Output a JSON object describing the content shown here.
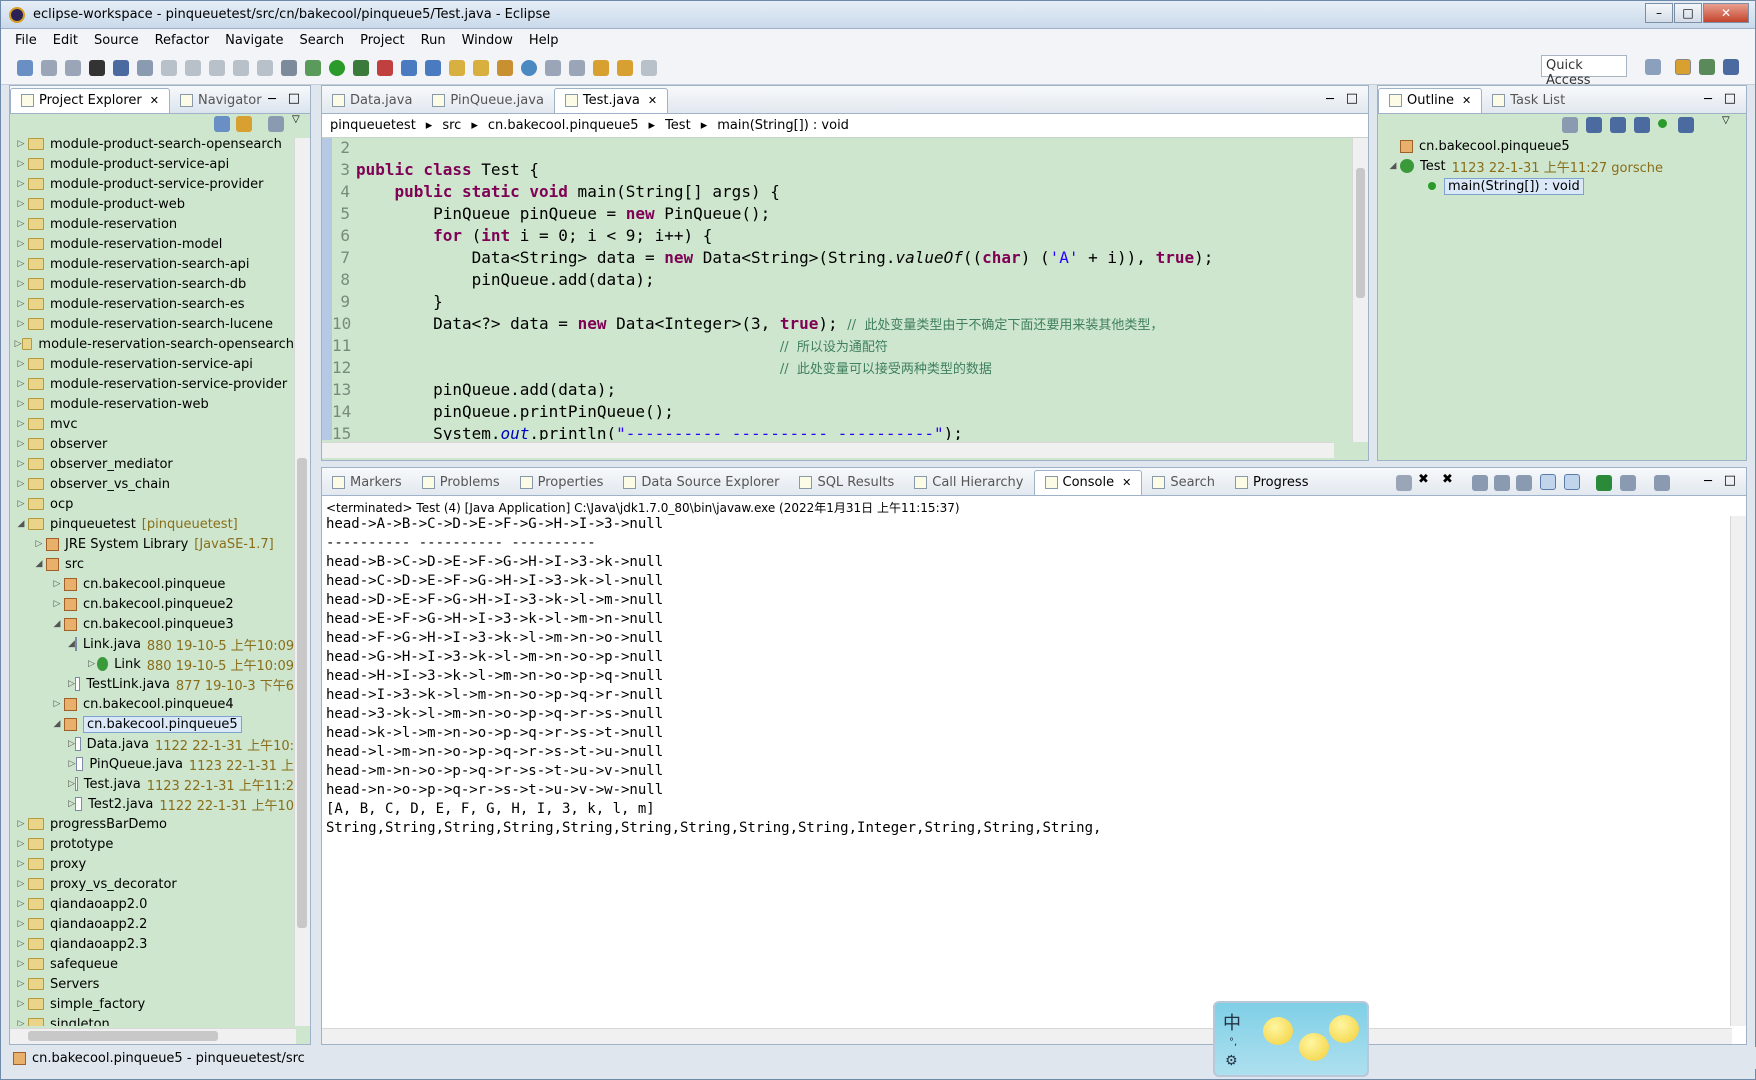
{
  "window": {
    "title": "eclipse-workspace - pinqueuetest/src/cn/bakecool/pinqueue5/Test.java - Eclipse"
  },
  "menu": [
    "File",
    "Edit",
    "Source",
    "Refactor",
    "Navigate",
    "Search",
    "Project",
    "Run",
    "Window",
    "Help"
  ],
  "quick_access": "Quick Access",
  "left": {
    "tabs": [
      "Project Explorer",
      "Navigator"
    ],
    "tree": [
      {
        "l": 0,
        "a": "▷",
        "i": "fold",
        "t": "module-product-search-opensearch"
      },
      {
        "l": 0,
        "a": "▷",
        "i": "fold",
        "t": "module-product-service-api"
      },
      {
        "l": 0,
        "a": "▷",
        "i": "fold",
        "t": "module-product-service-provider"
      },
      {
        "l": 0,
        "a": "▷",
        "i": "fold",
        "t": "module-product-web"
      },
      {
        "l": 0,
        "a": "▷",
        "i": "fold",
        "t": "module-reservation"
      },
      {
        "l": 0,
        "a": "▷",
        "i": "fold",
        "t": "module-reservation-model"
      },
      {
        "l": 0,
        "a": "▷",
        "i": "fold",
        "t": "module-reservation-search-api"
      },
      {
        "l": 0,
        "a": "▷",
        "i": "fold",
        "t": "module-reservation-search-db"
      },
      {
        "l": 0,
        "a": "▷",
        "i": "fold",
        "t": "module-reservation-search-es"
      },
      {
        "l": 0,
        "a": "▷",
        "i": "fold",
        "t": "module-reservation-search-lucene"
      },
      {
        "l": 0,
        "a": "▷",
        "i": "fold",
        "t": "module-reservation-search-opensearch"
      },
      {
        "l": 0,
        "a": "▷",
        "i": "fold",
        "t": "module-reservation-service-api"
      },
      {
        "l": 0,
        "a": "▷",
        "i": "fold",
        "t": "module-reservation-service-provider"
      },
      {
        "l": 0,
        "a": "▷",
        "i": "fold",
        "t": "module-reservation-web"
      },
      {
        "l": 0,
        "a": "▷",
        "i": "fold",
        "t": "mvc"
      },
      {
        "l": 0,
        "a": "▷",
        "i": "fold",
        "t": "observer"
      },
      {
        "l": 0,
        "a": "▷",
        "i": "fold",
        "t": "observer_mediator"
      },
      {
        "l": 0,
        "a": "▷",
        "i": "fold",
        "t": "observer_vs_chain"
      },
      {
        "l": 0,
        "a": "▷",
        "i": "fold",
        "t": "ocp"
      },
      {
        "l": 0,
        "a": "◢",
        "i": "fold",
        "t": "pinqueuetest",
        "m": "[pinqueuetest]"
      },
      {
        "l": 1,
        "a": "▷",
        "i": "pkg",
        "t": "JRE System Library",
        "m": "[JavaSE-1.7]"
      },
      {
        "l": 1,
        "a": "◢",
        "i": "pkg",
        "t": "src"
      },
      {
        "l": 2,
        "a": "▷",
        "i": "pkg",
        "t": "cn.bakecool.pinqueue"
      },
      {
        "l": 2,
        "a": "▷",
        "i": "pkg",
        "t": "cn.bakecool.pinqueue2"
      },
      {
        "l": 2,
        "a": "◢",
        "i": "pkg",
        "t": "cn.bakecool.pinqueue3"
      },
      {
        "l": 3,
        "a": "◢",
        "i": "jfile",
        "t": "Link.java",
        "m": "880  19-10-5 上午10:09"
      },
      {
        "l": 4,
        "a": "▷",
        "i": "cls",
        "t": "Link",
        "m": "880  19-10-5 上午10:09"
      },
      {
        "l": 3,
        "a": "▷",
        "i": "jfile",
        "t": "TestLink.java",
        "m": "877  19-10-3 下午6"
      },
      {
        "l": 2,
        "a": "▷",
        "i": "pkg",
        "t": "cn.bakecool.pinqueue4"
      },
      {
        "l": 2,
        "a": "◢",
        "i": "pkg",
        "t": "cn.bakecool.pinqueue5",
        "sel": true
      },
      {
        "l": 3,
        "a": "▷",
        "i": "jfile",
        "t": "Data.java",
        "m": "1122  22-1-31 上午10:"
      },
      {
        "l": 3,
        "a": "▷",
        "i": "jfile",
        "t": "PinQueue.java",
        "m": "1123  22-1-31 上"
      },
      {
        "l": 3,
        "a": "▷",
        "i": "jfile",
        "t": "Test.java",
        "m": "1123  22-1-31 上午11:2"
      },
      {
        "l": 3,
        "a": "▷",
        "i": "jfile",
        "t": "Test2.java",
        "m": "1122  22-1-31 上午10"
      },
      {
        "l": 0,
        "a": "▷",
        "i": "fold",
        "t": "progressBarDemo"
      },
      {
        "l": 0,
        "a": "▷",
        "i": "fold",
        "t": "prototype"
      },
      {
        "l": 0,
        "a": "▷",
        "i": "fold",
        "t": "proxy"
      },
      {
        "l": 0,
        "a": "▷",
        "i": "fold",
        "t": "proxy_vs_decorator"
      },
      {
        "l": 0,
        "a": "▷",
        "i": "fold",
        "t": "qiandaoapp2.0"
      },
      {
        "l": 0,
        "a": "▷",
        "i": "fold",
        "t": "qiandaoapp2.2"
      },
      {
        "l": 0,
        "a": "▷",
        "i": "fold",
        "t": "qiandaoapp2.3"
      },
      {
        "l": 0,
        "a": "▷",
        "i": "fold",
        "t": "safequeue"
      },
      {
        "l": 0,
        "a": "▷",
        "i": "fold",
        "t": "Servers"
      },
      {
        "l": 0,
        "a": "▷",
        "i": "fold",
        "t": "simple_factory"
      },
      {
        "l": 0,
        "a": "▷",
        "i": "fold",
        "t": "singleton"
      }
    ]
  },
  "editor": {
    "tabs": [
      "Data.java",
      "PinQueue.java",
      "Test.java"
    ],
    "breadcrumb": [
      "pinqueuetest",
      "src",
      "cn.bakecool.pinqueue5",
      "Test",
      "main(String[]) : void"
    ],
    "line_numbers": [
      "2",
      "3",
      "4",
      "5",
      "6",
      "7",
      "8",
      "9",
      "10",
      "11",
      "12",
      "13",
      "14",
      "15"
    ]
  },
  "outline": {
    "tabs": [
      "Outline",
      "Task List"
    ],
    "items": [
      {
        "t": "cn.bakecool.pinqueue5",
        "m": ""
      },
      {
        "t": "Test",
        "m": "1123  22-1-31 上午11:27  gorsche"
      },
      {
        "t": "main(String[]) : void",
        "m": ""
      }
    ]
  },
  "bottom": {
    "tabs": [
      "Markers",
      "Problems",
      "Properties",
      "Data Source Explorer",
      "SQL Results",
      "Call Hierarchy",
      "Console",
      "Search",
      "Progress"
    ],
    "header": "<terminated> Test (4) [Java Application] C:\\Java\\jdk1.7.0_80\\bin\\javaw.exe (2022年1月31日 上午11:15:37)",
    "lines": [
      "head->A->B->C->D->E->F->G->H->I->3->null",
      "---------- ---------- ----------",
      "head->B->C->D->E->F->G->H->I->3->k->null",
      "head->C->D->E->F->G->H->I->3->k->l->null",
      "head->D->E->F->G->H->I->3->k->l->m->null",
      "head->E->F->G->H->I->3->k->l->m->n->null",
      "head->F->G->H->I->3->k->l->m->n->o->null",
      "head->G->H->I->3->k->l->m->n->o->p->null",
      "head->H->I->3->k->l->m->n->o->p->q->null",
      "head->I->3->k->l->m->n->o->p->q->r->null",
      "head->3->k->l->m->n->o->p->q->r->s->null",
      "head->k->l->m->n->o->p->q->r->s->t->null",
      "head->l->m->n->o->p->q->r->s->t->u->null",
      "head->m->n->o->p->q->r->s->t->u->v->null",
      "head->n->o->p->q->r->s->t->u->v->w->null",
      "[A, B, C, D, E, F, G, H, I, 3, k, l, m]",
      "String,String,String,String,String,String,String,String,String,Integer,String,String,String,"
    ]
  },
  "status": "cn.bakecool.pinqueue5 - pinqueuetest/src",
  "ime": {
    "label": "中"
  }
}
